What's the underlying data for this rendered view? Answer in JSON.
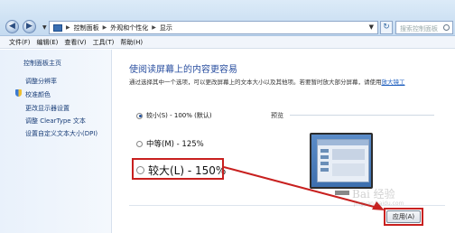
{
  "address": {
    "crumbs": [
      "控制面板",
      "外观和个性化",
      "显示"
    ],
    "search_placeholder": "搜索控制面板"
  },
  "menu": [
    "文件(F)",
    "编辑(E)",
    "查看(V)",
    "工具(T)",
    "帮助(H)"
  ],
  "sidebar": {
    "home": "控制面板主页",
    "links": [
      "调整分辨率",
      "校准颜色",
      "更改显示器设置",
      "调整 ClearType 文本",
      "设置自定义文本大小(DPI)"
    ]
  },
  "main": {
    "title": "使阅读屏幕上的内容更容易",
    "description": "通过选择其中一个选项，可以更改屏幕上的文本大小以及其他项。若要暂时放大部分屏幕，请使用",
    "description_link": "放大镜工",
    "options": [
      {
        "label": "较小(S) - 100% (默认)",
        "selected": true
      },
      {
        "label": "中等(M) - 125%",
        "selected": false
      },
      {
        "label": "较大(L) - 150%",
        "selected": false
      }
    ],
    "preview_label": "预览",
    "apply_label": "应用(A)"
  },
  "watermark": {
    "text": "Bai 经验",
    "sub": "jingyan.baidu.com"
  },
  "colors": {
    "highlight": "#c8201f",
    "link": "#1f5fbf",
    "title": "#2a4fa0"
  }
}
